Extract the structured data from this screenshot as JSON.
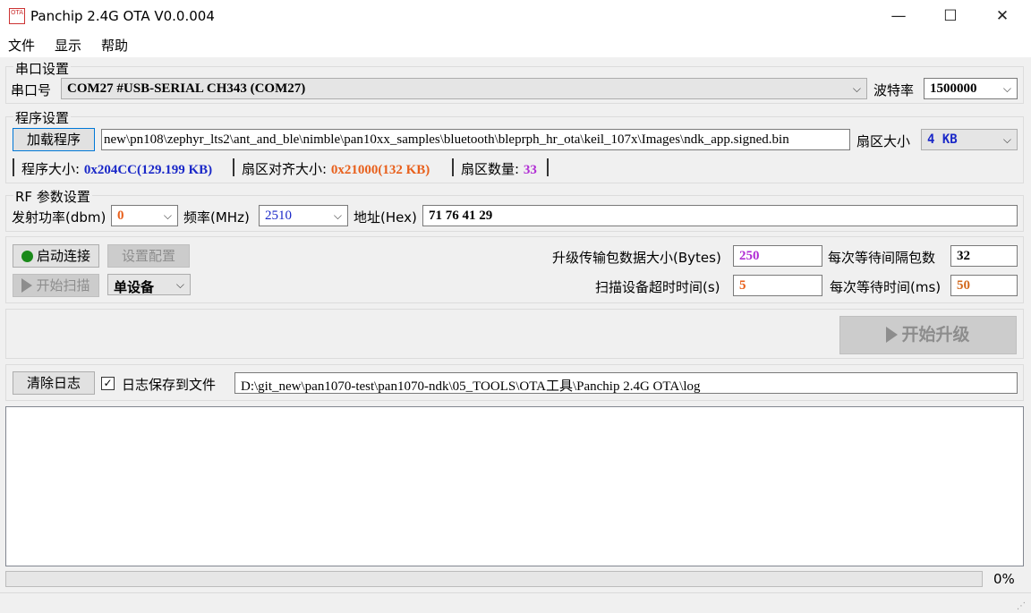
{
  "window": {
    "title": "Panchip 2.4G OTA V0.0.004",
    "app_icon_text": "OTA",
    "minimize": "—",
    "maximize": "☐",
    "close": "✕"
  },
  "menu": [
    "文件",
    "显示",
    "帮助"
  ],
  "serial": {
    "group_title": "串口设置",
    "port_label": "串口号",
    "port_value": "COM27 #USB-SERIAL CH343 (COM27)",
    "baud_label": "波特率",
    "baud_value": "1500000"
  },
  "program": {
    "group_title": "程序设置",
    "load_button": "加载程序",
    "path": "new\\pn108\\zephyr_lts2\\ant_and_ble\\nimble\\pan10xx_samples\\bluetooth\\bleprph_hr_ota\\keil_107x\\Images\\ndk_app.signed.bin",
    "sector_size_label": "扇区大小",
    "sector_size_value": "4 KB",
    "program_size_label": "程序大小: ",
    "program_size_value": "0x204CC(129.199 KB)",
    "align_size_label": "扇区对齐大小: ",
    "align_size_value": "0x21000(132 KB)",
    "sector_count_label": "扇区数量: ",
    "sector_count_value": "33"
  },
  "rf": {
    "group_title": "RF 参数设置",
    "power_label": "发射功率(dbm)",
    "power_value": "0",
    "freq_label": "频率(MHz)",
    "freq_value": "2510",
    "addr_label": "地址(Hex)",
    "addr_value": "71 76 41 29"
  },
  "control": {
    "connect_button": "启动连接",
    "config_button": "设置配置",
    "scan_button": "开始扫描",
    "device_mode": "单设备",
    "packet_size_label": "升级传输包数据大小(Bytes)",
    "packet_size_value": "250",
    "wait_packets_label": "每次等待间隔包数",
    "wait_packets_value": "32",
    "scan_timeout_label": "扫描设备超时时间(s)",
    "scan_timeout_value": "5",
    "wait_time_label": "每次等待时间(ms)",
    "wait_time_value": "50"
  },
  "upgrade": {
    "start_button": "开始升级"
  },
  "log": {
    "clear_button": "清除日志",
    "save_checkbox_label": "日志保存到文件",
    "save_checked": true,
    "check_mark": "✓",
    "path": "D:\\git_new\\pan1070-test\\pan1070-ndk\\05_TOOLS\\OTA工具\\Panchip 2.4G OTA\\log"
  },
  "progress": {
    "value": 0,
    "label": "0%"
  },
  "colors": {
    "blue": "#1a28c8",
    "orange": "#e8601c",
    "purple": "#b02cd4",
    "dark_orange": "#d2691e"
  }
}
